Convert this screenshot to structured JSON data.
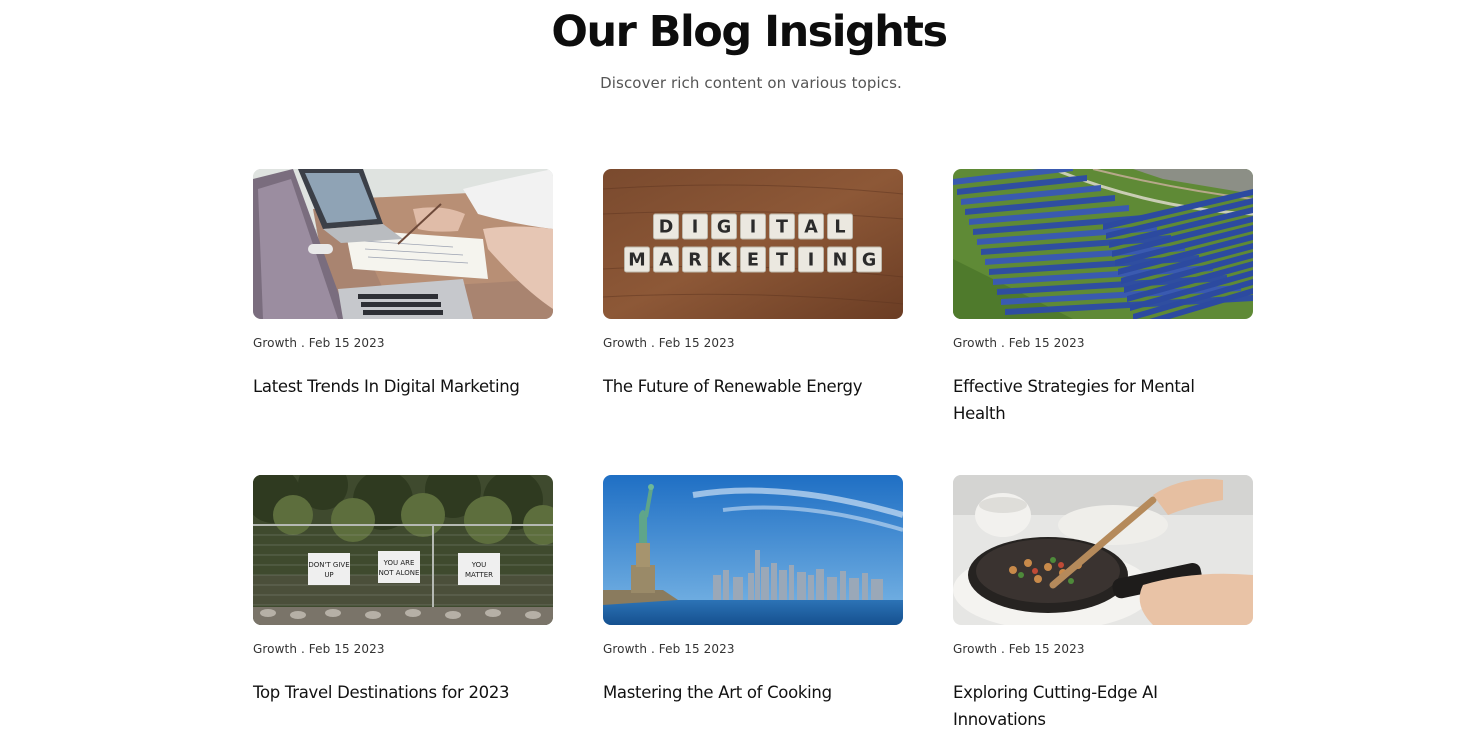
{
  "header": {
    "title": "Our Blog Insights",
    "subtitle": "Discover rich content on various topics."
  },
  "posts": [
    {
      "category": "Growth",
      "date": "Feb 15 2023",
      "meta": "Growth . Feb 15 2023",
      "title": "Latest Trends In Digital Marketing",
      "image": "laptop-meeting-photo"
    },
    {
      "category": "Growth",
      "date": "Feb 15 2023",
      "meta": "Growth . Feb 15 2023",
      "title": "The Future of Renewable Energy",
      "image": "digital-marketing-tiles-photo",
      "image_text_line1": "DIGITAL",
      "image_text_line2": "MARKETING"
    },
    {
      "category": "Growth",
      "date": "Feb 15 2023",
      "meta": "Growth . Feb 15 2023",
      "title": "Effective Strategies for Mental Health",
      "image": "solar-farm-aerial-photo"
    },
    {
      "category": "Growth",
      "date": "Feb 15 2023",
      "meta": "Growth . Feb 15 2023",
      "title": "Top Travel Destinations for 2023",
      "image": "fence-signs-photo",
      "signs": [
        "DON'T GIVE UP",
        "YOU ARE NOT ALONE",
        "YOU MATTER"
      ]
    },
    {
      "category": "Growth",
      "date": "Feb 15 2023",
      "meta": "Growth . Feb 15 2023",
      "title": "Mastering the Art of Cooking",
      "image": "statue-of-liberty-skyline-photo"
    },
    {
      "category": "Growth",
      "date": "Feb 15 2023",
      "meta": "Growth . Feb 15 2023",
      "title": "Exploring Cutting-Edge AI Innovations",
      "image": "cooking-pan-photo"
    }
  ]
}
